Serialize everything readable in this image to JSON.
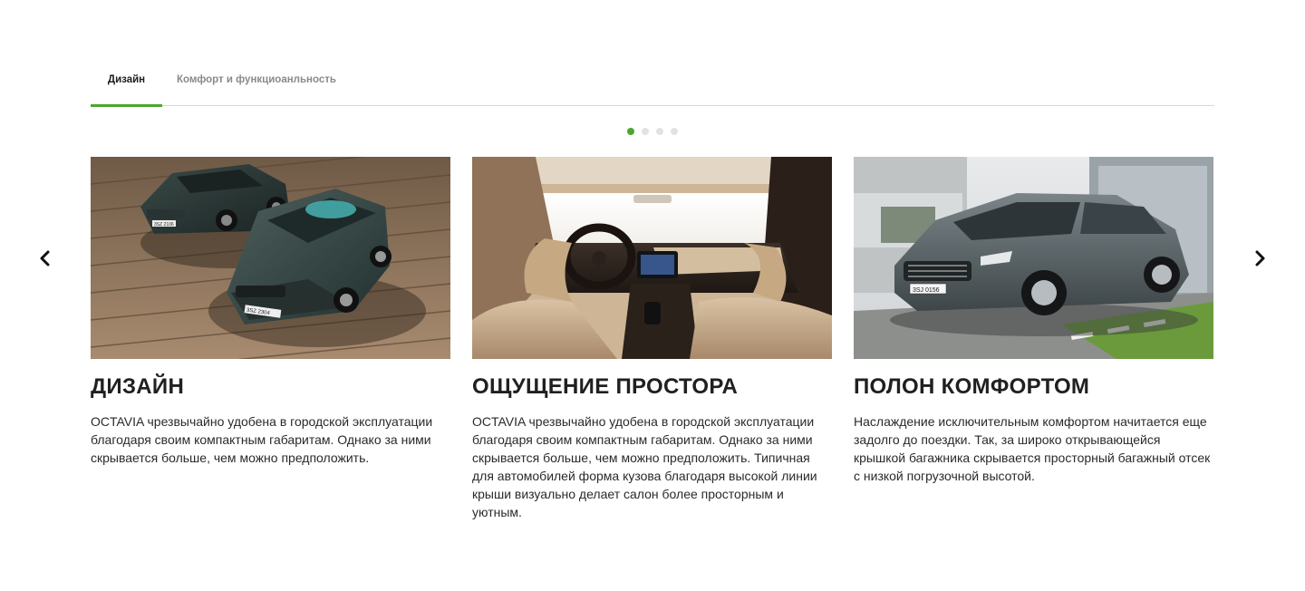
{
  "tabs": [
    {
      "label": "Дизайн",
      "active": true
    },
    {
      "label": "Комфорт и функциоанльность",
      "active": false
    }
  ],
  "pagination": {
    "count": 4,
    "active_index": 0
  },
  "colors": {
    "accent": "#4ba82e",
    "tab_underline": "#d8d8d8",
    "dot_inactive": "#e2e2e2"
  },
  "icons": {
    "prev": "chevron-left-icon",
    "next": "chevron-right-icon"
  },
  "cards": [
    {
      "image": "two-dark-green-cars-on-wooden-deck",
      "title": "ДИЗАЙН",
      "text": "OCTAVIA чрезвычайно удобена в городской эксплуатации благодаря своим компактным габаритам. Однако за ними скрывается больше, чем можно предположить."
    },
    {
      "image": "beige-car-interior-dashboard",
      "title": "ОЩУЩЕНИЕ ПРОСТОРА",
      "text": "OCTAVIA чрезвычайно удобена в городской эксплуатации благодаря своим компактным габаритам. Однако за ними скрывается больше, чем можно предположить. Типичная для автомобилей форма кузова благодаря высокой линии крыши визуально делает салон более просторным и уютным."
    },
    {
      "image": "grey-sedan-in-front-of-modern-house",
      "title": "ПОЛОН КОМФОРТОМ",
      "text": "Наслаждение исключительным комфортом начитается еще задолго до поездки. Так, за широко открывающейся крышкой багажника скрывается просторный багажный отсек с низкой погрузочной высотой."
    }
  ],
  "plates": {
    "card1_a": "3SZ 2106",
    "card1_b": "3SZ 2304",
    "card3": "3SJ 0156"
  }
}
